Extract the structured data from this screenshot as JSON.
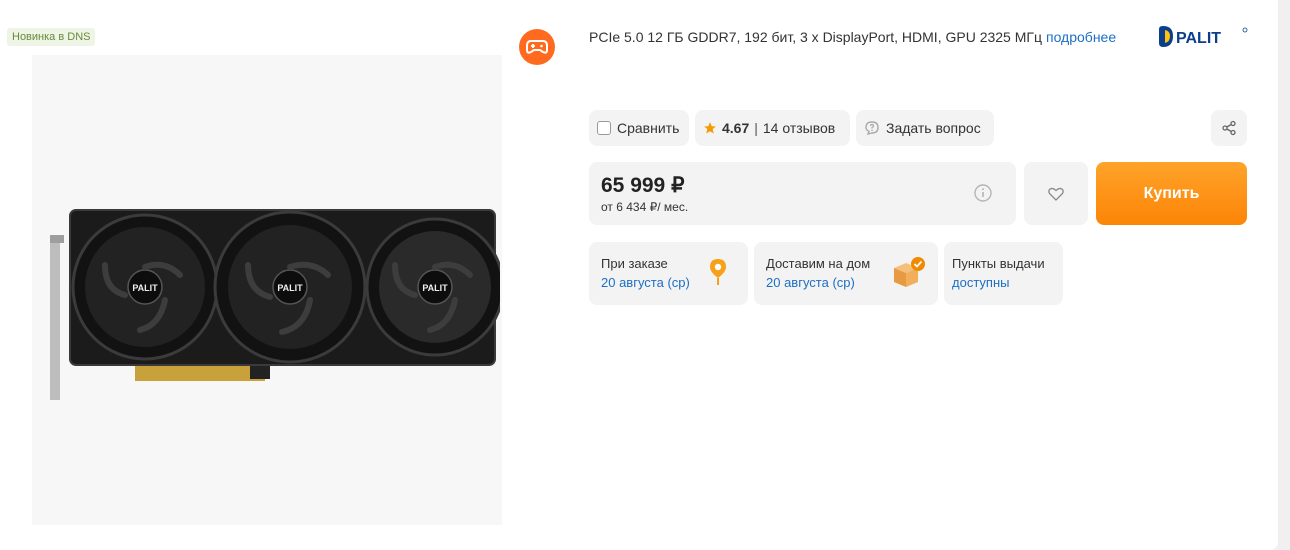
{
  "badge": {
    "new_label": "Новинка в DNS"
  },
  "product": {
    "specs": "PCIe 5.0 12 ГБ GDDR7, 192 бит, 3 x DisplayPort, HDMI, GPU 2325 МГц",
    "details_link": "подробнее",
    "brand": "PALIT",
    "image_brand_label": "PALIT"
  },
  "actions": {
    "compare_label": "Сравнить",
    "rating_value": "4.67",
    "reviews_label": "14 отзывов",
    "question_label": "Задать вопрос"
  },
  "price": {
    "main": "65 999 ₽",
    "installment": "от 6 434 ₽/ мес."
  },
  "buy": {
    "label": "Купить"
  },
  "delivery": {
    "pickup_title": "При заказе",
    "pickup_date": "20 августа (ср)",
    "home_title": "Доставим на дом",
    "home_date": "20 августа (ср)",
    "points_title": "Пункты выдачи",
    "points_status": "доступны"
  },
  "colors": {
    "accent_orange": "#fc8507",
    "link_blue": "#1d6fc4",
    "star": "#f29b00",
    "game_icon_bg": "#ff6a1f"
  },
  "icons": {
    "game": "gamepad-icon",
    "brand": "palit-logo",
    "star": "star-icon",
    "question": "chat-question-icon",
    "share": "share-icon",
    "info": "info-icon",
    "favorite": "heart-icon",
    "pickup": "map-pin-icon",
    "home_delivery": "box-check-icon"
  }
}
